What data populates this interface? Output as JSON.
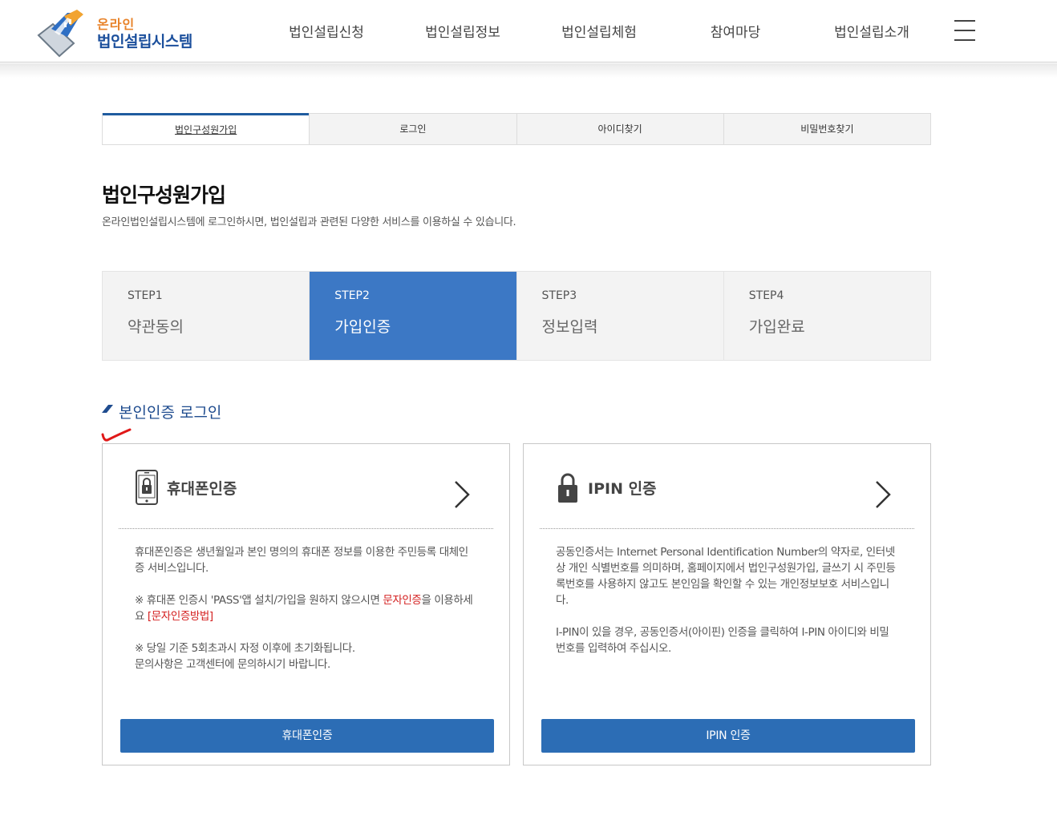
{
  "header": {
    "logo_line1": "온라인",
    "logo_line2": "법인설립시스템",
    "nav": [
      "법인설립신청",
      "법인설립정보",
      "법인설립체험",
      "참여마당",
      "법인설립소개"
    ]
  },
  "tabs": [
    {
      "label": "법인구성원가입",
      "active": true
    },
    {
      "label": "로그인",
      "active": false
    },
    {
      "label": "아이디찾기",
      "active": false
    },
    {
      "label": "비밀번호찾기",
      "active": false
    }
  ],
  "page": {
    "title": "법인구성원가입",
    "description": "온라인법인설립시스템에 로그인하시면, 법인설립과 관련된 다양한 서비스를 이용하실 수 있습니다."
  },
  "steps": [
    {
      "num": "STEP1",
      "label": "약관동의",
      "active": false
    },
    {
      "num": "STEP2",
      "label": "가입인증",
      "active": true
    },
    {
      "num": "STEP3",
      "label": "정보입력",
      "active": false
    },
    {
      "num": "STEP4",
      "label": "가입완료",
      "active": false
    }
  ],
  "section": {
    "title": "본인인증 로그인"
  },
  "phone_card": {
    "title": "휴대폰인증",
    "para1": "휴대폰인증은 생년월일과 본인 명의의 휴대폰 정보를 이용한 주민등록 대체인증 서비스입니다.",
    "para2_a": "※ 휴대폰 인증시 'PASS'앱 설치/가입을 원하지 않으시면 ",
    "para2_red1": "문자인증",
    "para2_b": "을 이용하세요 ",
    "para2_red2": "[문자인증방법]",
    "para3_line1": "※ 당일 기준 5회초과시 자정 이후에 초기화됩니다.",
    "para3_line2": "문의사항은 고객센터에 문의하시기 바랍니다.",
    "button": "휴대폰인증"
  },
  "ipin_card": {
    "title": "IPIN 인증",
    "para1": "공동인증서는 Internet Personal Identification Number의 약자로, 인터넷상 개인 식별번호를 의미하며, 홈페이지에서 법인구성원가입, 글쓰기 시 주민등록번호를 사용하지 않고도 본인임을 확인할 수 있는 개인정보보호 서비스입니다.",
    "para2": "I-PIN이 있을 경우, 공동인증서(아이핀) 인증을 클릭하여 I-PIN 아이디와 비밀번호를 입력하여 주십시오.",
    "button": "IPIN 인증"
  },
  "colors": {
    "accent": "#3c78c5",
    "button": "#2c6db5",
    "title_blue": "#1f4c8f",
    "logo_orange": "#e8832a",
    "highlight_red": "#d42020"
  }
}
